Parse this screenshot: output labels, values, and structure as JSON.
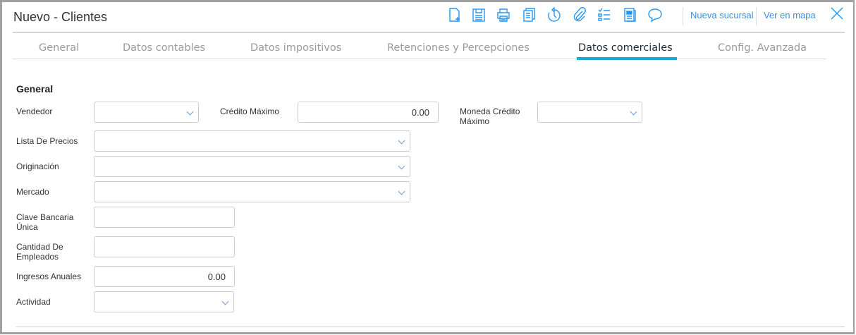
{
  "header": {
    "title": "Nuevo - Clientes",
    "links": {
      "new_branch": "Nueva sucursal",
      "view_map": "Ver en mapa"
    },
    "icons": [
      "new-document-icon",
      "save-icon",
      "print-icon",
      "copy-icon",
      "history-icon",
      "attachment-icon",
      "checklist-icon",
      "report-icon",
      "comment-icon",
      "close-icon"
    ]
  },
  "tabs": [
    {
      "label": "General"
    },
    {
      "label": "Datos contables"
    },
    {
      "label": "Datos impositivos"
    },
    {
      "label": "Retenciones y Percepciones"
    },
    {
      "label": "Datos comerciales",
      "active": true
    },
    {
      "label": "Config. Avanzada"
    }
  ],
  "accent": "#1aa9d4",
  "form": {
    "section": "General",
    "vendedor": {
      "label": "Vendedor",
      "value": ""
    },
    "credito_maximo": {
      "label": "Crédito Máximo",
      "value": "0.00"
    },
    "moneda_credito": {
      "label": "Moneda Crédito Máximo",
      "value": ""
    },
    "lista_precios": {
      "label": "Lista De Precios",
      "value": ""
    },
    "originacion": {
      "label": "Originación",
      "value": ""
    },
    "mercado": {
      "label": "Mercado",
      "value": ""
    },
    "clabe": {
      "label": "Clave Bancaria Única",
      "value": ""
    },
    "empleados": {
      "label": "Cantidad De Empleados",
      "value": ""
    },
    "ingresos": {
      "label": "Ingresos Anuales",
      "value": "0.00"
    },
    "actividad": {
      "label": "Actividad",
      "value": ""
    }
  }
}
